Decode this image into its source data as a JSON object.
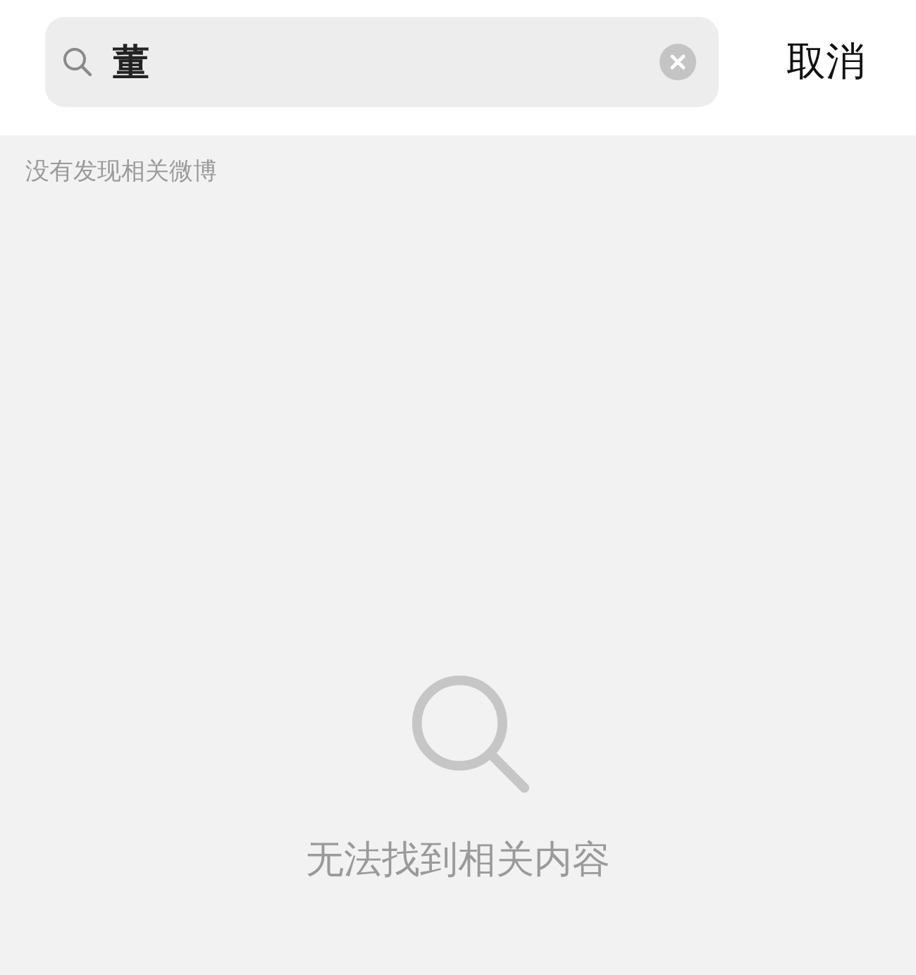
{
  "search": {
    "value": "董",
    "cancel": "取消"
  },
  "hint": "没有发现相关微博",
  "empty_state": {
    "message": "无法找到相关内容"
  }
}
